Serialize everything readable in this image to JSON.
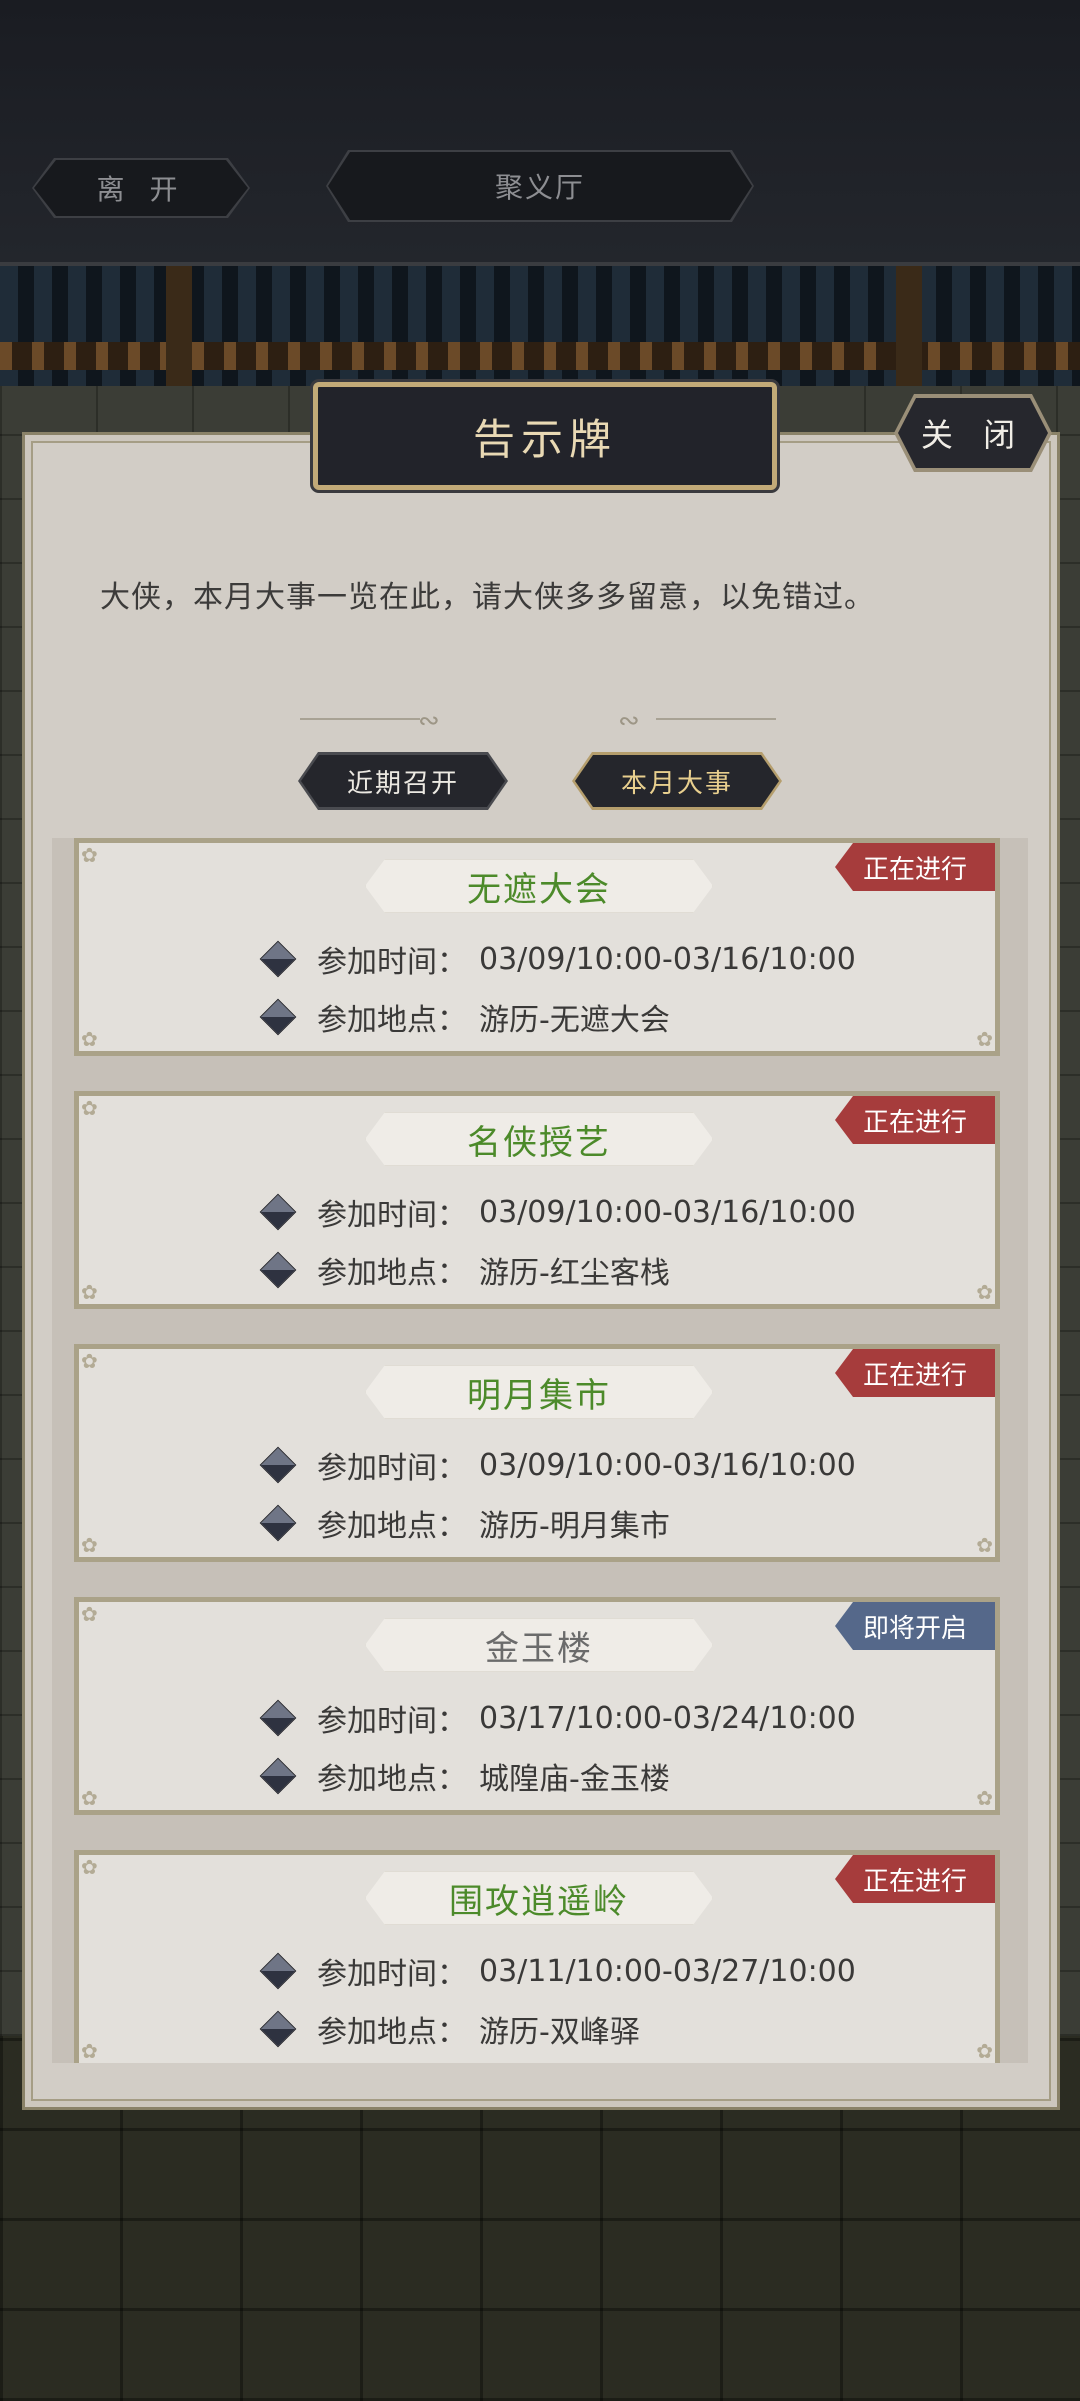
{
  "topbar": {
    "leave_label": "离 开",
    "hall_title": "聚义厅"
  },
  "panel": {
    "title": "告示牌",
    "close_label": "关 闭",
    "intro": "大侠，本月大事一览在此，请大侠多多留意，以免错过。",
    "tabs": [
      {
        "label": "近期召开",
        "active": false
      },
      {
        "label": "本月大事",
        "active": true
      }
    ]
  },
  "events": [
    {
      "name": "无遮大会",
      "status": "正在进行",
      "time_label": "参加时间：",
      "time": "03/09/10:00-03/16/10:00",
      "place_label": "参加地点：",
      "place": "游历-无遮大会"
    },
    {
      "name": "名侠授艺",
      "status": "正在进行",
      "time_label": "参加时间：",
      "time": "03/09/10:00-03/16/10:00",
      "place_label": "参加地点：",
      "place": "游历-红尘客栈"
    },
    {
      "name": "明月集市",
      "status": "正在进行",
      "time_label": "参加时间：",
      "time": "03/09/10:00-03/16/10:00",
      "place_label": "参加地点：",
      "place": "游历-明月集市"
    },
    {
      "name": "金玉楼",
      "status": "即将开启",
      "time_label": "参加时间：",
      "time": "03/17/10:00-03/24/10:00",
      "place_label": "参加地点：",
      "place": "城隍庙-金玉楼"
    },
    {
      "name": "围攻逍遥岭",
      "status": "正在进行",
      "time_label": "参加时间：",
      "time": "03/11/10:00-03/27/10:00",
      "place_label": "参加地点：",
      "place": "游历-双峰驿"
    }
  ],
  "colors": {
    "status_active": "#a63c3c",
    "status_upcoming": "#55688a",
    "name_active": "#4c8a2a",
    "name_upcoming": "#6b6b6b"
  }
}
